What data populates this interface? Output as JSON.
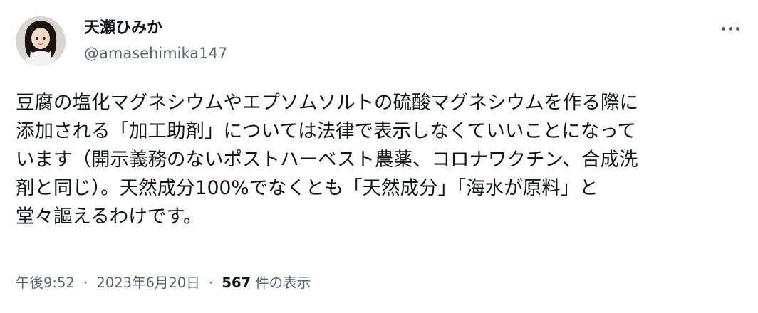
{
  "user": {
    "display_name": "天瀬ひみか",
    "handle": "@amasehimika147",
    "avatar_icon": "profile-photo"
  },
  "more_icon": "ellipsis-icon",
  "tweet": {
    "lines": [
      "豆腐の塩化マグネシウムやエプソムソルトの硫酸マグネシウムを作る際に",
      "添加される「加工助剤」については法律で表示しなくていいことになって",
      "います（開示義務のないポストハーベスト農薬、コロナワクチン、合成洗",
      "剤と同じ）。天然成分100%でなくとも「天然成分」「海水が原料」と",
      "堂々謳えるわけです。"
    ]
  },
  "meta": {
    "time": "午後9:52",
    "separator": "·",
    "date": "2023年6月20日",
    "views_count": "567",
    "views_label": "件の表示"
  }
}
